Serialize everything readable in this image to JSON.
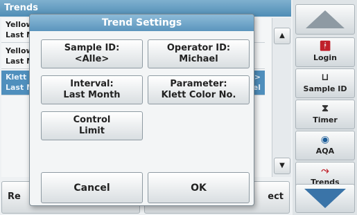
{
  "background": {
    "title": "Trends",
    "rows": [
      {
        "left1": "Yellow",
        "left2": "Last M",
        "right1": "",
        "right2": ""
      },
      {
        "left1": "Yellow",
        "left2": "Last M",
        "right1": "",
        "right2": ""
      },
      {
        "left1": "Klett C",
        "left2": "Last M",
        "right1": "e>",
        "right2": "el"
      }
    ],
    "bottom_left": "Re",
    "bottom_right": "ect"
  },
  "toolbar": {
    "login": "Login",
    "sample_id": "Sample ID",
    "timer": "Timer",
    "aqa": "AQA",
    "trends": "Trends"
  },
  "dialog": {
    "title": "Trend Settings",
    "sample_id_label": "Sample ID:",
    "sample_id_value": "<Alle>",
    "operator_id_label": "Operator ID:",
    "operator_id_value": "Michael",
    "interval_label": "Interval:",
    "interval_value": "Last Month",
    "parameter_label": "Parameter:",
    "parameter_value": "Klett Color No.",
    "control_line1": "Control",
    "control_line2": "Limit",
    "cancel": "Cancel",
    "ok": "OK"
  }
}
